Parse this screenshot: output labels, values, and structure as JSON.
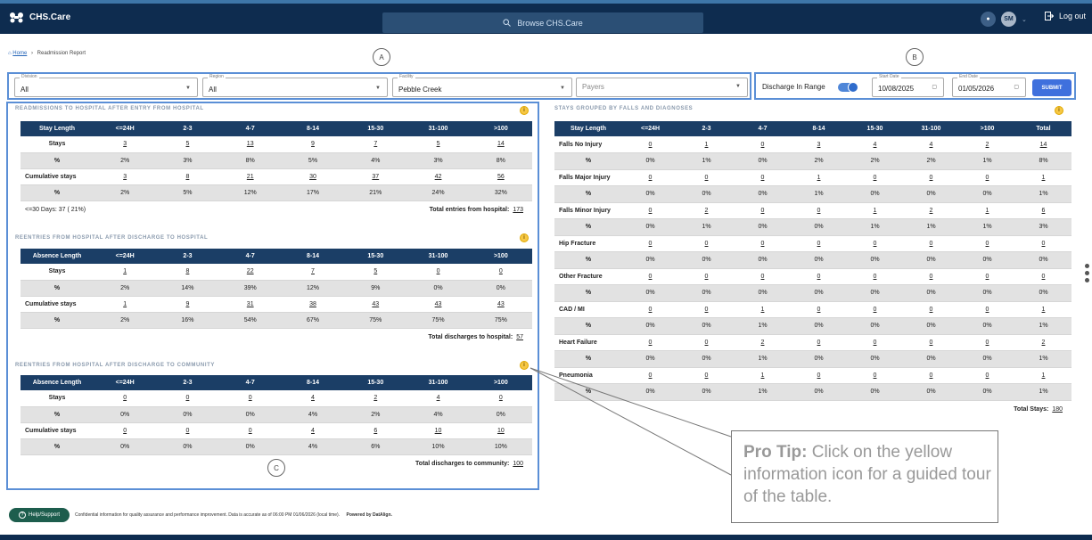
{
  "app": {
    "title": "CHS.Care",
    "search_placeholder": "Browse CHS.Care",
    "user_initials": "SM",
    "logout": "Log out"
  },
  "breadcrumb": {
    "home": "Home",
    "separator": "›",
    "current": "Readmission Report"
  },
  "markers": {
    "a": "A",
    "b": "B",
    "c": "C"
  },
  "filters": {
    "division": {
      "label": "Division",
      "value": "All"
    },
    "region": {
      "label": "Region",
      "value": "All"
    },
    "facility": {
      "label": "Facility",
      "value": "Pebble Creek"
    },
    "payers": {
      "placeholder": "Payers"
    }
  },
  "dates": {
    "discharge_label": "Discharge In Range",
    "discharge_on": true,
    "start_label": "Start Date",
    "start_value": "10/08/2025",
    "end_label": "End Date",
    "end_value": "01/05/2026",
    "submit": "SUBMIT"
  },
  "readmissions": {
    "title": "READMISSIONS TO HOSPITAL AFTER ENTRY FROM HOSPITAL",
    "headers": [
      "Stay Length",
      "<=24H",
      "2-3",
      "4-7",
      "8-14",
      "15-30",
      "31-100",
      ">100"
    ],
    "rows": [
      {
        "label": "Stays",
        "values": [
          "3",
          "5",
          "13",
          "9",
          "7",
          "5",
          "14"
        ],
        "links": true
      },
      {
        "label": "%",
        "values": [
          "2%",
          "3%",
          "8%",
          "5%",
          "4%",
          "3%",
          "8%"
        ],
        "links": false
      },
      {
        "label": "Cumulative stays",
        "values": [
          "3",
          "8",
          "21",
          "30",
          "37",
          "42",
          "56"
        ],
        "links": true
      },
      {
        "label": "%",
        "values": [
          "2%",
          "5%",
          "12%",
          "17%",
          "21%",
          "24%",
          "32%"
        ],
        "links": false
      }
    ],
    "footer_left": "<=30 Days: 37 ( 21%)",
    "footer_label": "Total entries from hospital:",
    "footer_value": "173"
  },
  "reentries_hospital": {
    "title": "REENTRIES FROM HOSPITAL AFTER DISCHARGE TO HOSPITAL",
    "headers": [
      "Absence Length",
      "<=24H",
      "2-3",
      "4-7",
      "8-14",
      "15-30",
      "31-100",
      ">100"
    ],
    "rows": [
      {
        "label": "Stays",
        "values": [
          "1",
          "8",
          "22",
          "7",
          "5",
          "0",
          "0"
        ],
        "links": true
      },
      {
        "label": "%",
        "values": [
          "2%",
          "14%",
          "39%",
          "12%",
          "9%",
          "0%",
          "0%"
        ],
        "links": false
      },
      {
        "label": "Cumulative stays",
        "values": [
          "1",
          "9",
          "31",
          "38",
          "43",
          "43",
          "43"
        ],
        "links": true
      },
      {
        "label": "%",
        "values": [
          "2%",
          "16%",
          "54%",
          "67%",
          "75%",
          "75%",
          "75%"
        ],
        "links": false
      }
    ],
    "footer_label": "Total discharges to hospital:",
    "footer_value": "57"
  },
  "reentries_community": {
    "title": "REENTRIES FROM HOSPITAL AFTER DISCHARGE TO COMMUNITY",
    "headers": [
      "Absence Length",
      "<=24H",
      "2-3",
      "4-7",
      "8-14",
      "15-30",
      "31-100",
      ">100"
    ],
    "rows": [
      {
        "label": "Stays",
        "values": [
          "0",
          "0",
          "0",
          "4",
          "2",
          "4",
          "0"
        ],
        "links": true
      },
      {
        "label": "%",
        "values": [
          "0%",
          "0%",
          "0%",
          "4%",
          "2%",
          "4%",
          "0%"
        ],
        "links": false
      },
      {
        "label": "Cumulative stays",
        "values": [
          "0",
          "0",
          "0",
          "4",
          "6",
          "10",
          "10"
        ],
        "links": true
      },
      {
        "label": "%",
        "values": [
          "0%",
          "0%",
          "0%",
          "4%",
          "6%",
          "10%",
          "10%"
        ],
        "links": false
      }
    ],
    "footer_label": "Total discharges to community:",
    "footer_value": "100"
  },
  "falls": {
    "title": "STAYS GROUPED BY FALLS AND DIAGNOSES",
    "headers": [
      "Stay Length",
      "<=24H",
      "2-3",
      "4-7",
      "8-14",
      "15-30",
      "31-100",
      ">100",
      "Total"
    ],
    "rows": [
      {
        "label": "Falls No Injury",
        "values": [
          "0",
          "1",
          "0",
          "3",
          "4",
          "4",
          "2",
          "14"
        ],
        "links": true
      },
      {
        "label": "%",
        "values": [
          "0%",
          "1%",
          "0%",
          "2%",
          "2%",
          "2%",
          "1%",
          "8%"
        ],
        "links": false
      },
      {
        "label": "Falls Major Injury",
        "values": [
          "0",
          "0",
          "0",
          "1",
          "0",
          "0",
          "0",
          "1"
        ],
        "links": true
      },
      {
        "label": "%",
        "values": [
          "0%",
          "0%",
          "0%",
          "1%",
          "0%",
          "0%",
          "0%",
          "1%"
        ],
        "links": false
      },
      {
        "label": "Falls Minor Injury",
        "values": [
          "0",
          "2",
          "0",
          "0",
          "1",
          "2",
          "1",
          "6"
        ],
        "links": true
      },
      {
        "label": "%",
        "values": [
          "0%",
          "1%",
          "0%",
          "0%",
          "1%",
          "1%",
          "1%",
          "3%"
        ],
        "links": false
      },
      {
        "label": "Hip Fracture",
        "values": [
          "0",
          "0",
          "0",
          "0",
          "0",
          "0",
          "0",
          "0"
        ],
        "links": true
      },
      {
        "label": "%",
        "values": [
          "0%",
          "0%",
          "0%",
          "0%",
          "0%",
          "0%",
          "0%",
          "0%"
        ],
        "links": false
      },
      {
        "label": "Other Fracture",
        "values": [
          "0",
          "0",
          "0",
          "0",
          "0",
          "0",
          "0",
          "0"
        ],
        "links": true
      },
      {
        "label": "%",
        "values": [
          "0%",
          "0%",
          "0%",
          "0%",
          "0%",
          "0%",
          "0%",
          "0%"
        ],
        "links": false
      },
      {
        "label": "CAD / MI",
        "values": [
          "0",
          "0",
          "1",
          "0",
          "0",
          "0",
          "0",
          "1"
        ],
        "links": true
      },
      {
        "label": "%",
        "values": [
          "0%",
          "0%",
          "1%",
          "0%",
          "0%",
          "0%",
          "0%",
          "1%"
        ],
        "links": false
      },
      {
        "label": "Heart Failure",
        "values": [
          "0",
          "0",
          "2",
          "0",
          "0",
          "0",
          "0",
          "2"
        ],
        "links": true
      },
      {
        "label": "%",
        "values": [
          "0%",
          "0%",
          "1%",
          "0%",
          "0%",
          "0%",
          "0%",
          "1%"
        ],
        "links": false
      },
      {
        "label": "Pneumonia",
        "values": [
          "0",
          "0",
          "1",
          "0",
          "0",
          "0",
          "0",
          "1"
        ],
        "links": true
      },
      {
        "label": "%",
        "values": [
          "0%",
          "0%",
          "1%",
          "0%",
          "0%",
          "0%",
          "0%",
          "1%"
        ],
        "links": false
      }
    ],
    "footer_label": "Total Stays:",
    "footer_value": "180"
  },
  "footer": {
    "help": "Help/Support",
    "disclaimer": "Confidential information for quality assurance and performance improvement. Data is accurate as of 06:00 PM 01/06/2026 (local time).",
    "powered": "Powered by DatAlign."
  },
  "tip": {
    "bold": "Pro Tip:",
    "text": " Click on the yellow information icon for a guided tour of the table."
  },
  "info_icon": "i"
}
